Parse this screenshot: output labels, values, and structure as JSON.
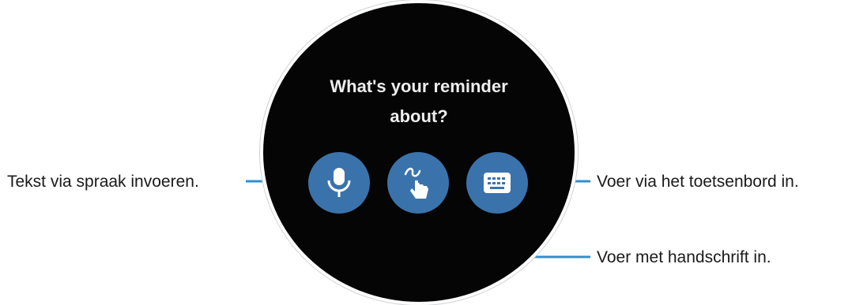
{
  "watch_screen": {
    "prompt_line1": "What's your reminder",
    "prompt_line2": "about?",
    "buttons": [
      {
        "icon": "microphone-icon"
      },
      {
        "icon": "handwriting-icon"
      },
      {
        "icon": "keyboard-icon"
      }
    ],
    "colors": {
      "screen": "#050505",
      "button": "#3a73ac",
      "callout_line": "#2f8fd0"
    }
  },
  "callouts": {
    "voice": "Tekst via spraak invoeren.",
    "keyboard": "Voer via het toetsenbord in.",
    "handwriting": "Voer met handschrift in."
  }
}
